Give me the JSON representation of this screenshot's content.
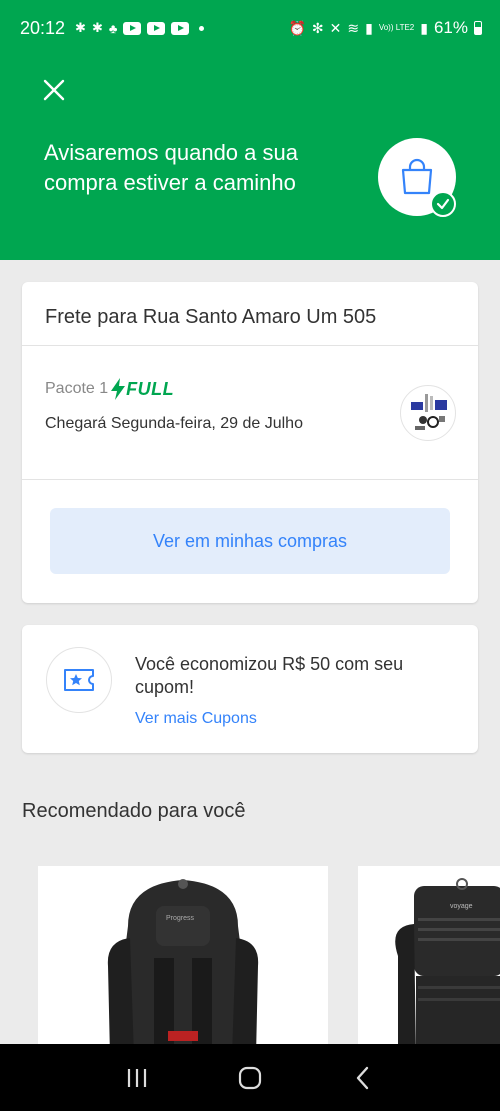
{
  "status_bar": {
    "time": "20:12",
    "signal_text": "Vo)) LTE2",
    "battery": "61%"
  },
  "header": {
    "title": "Avisaremos quando a sua compra estiver a caminho",
    "icons": [
      "close-icon",
      "shopping-bag-icon",
      "check-icon"
    ],
    "background_color": "#00a650"
  },
  "shipping": {
    "title": "Frete para Rua Santo Amaro Um 505",
    "package_label": "Pacote 1",
    "badge": "FULL",
    "arrival": "Chegará Segunda-feira, 29 de Julho",
    "button_label": "Ver em minhas compras"
  },
  "coupon": {
    "text": "Você economizou R$ 50 com seu cupom!",
    "link": "Ver mais Cupons"
  },
  "recommendations": {
    "title": "Recomendado para você",
    "items": [
      {
        "brand_mark": "Progress"
      },
      {
        "brand_mark": "voyage"
      }
    ]
  },
  "colors": {
    "brand_green": "#00a650",
    "link_blue": "#3483fa",
    "button_bg": "#e3edfb"
  }
}
